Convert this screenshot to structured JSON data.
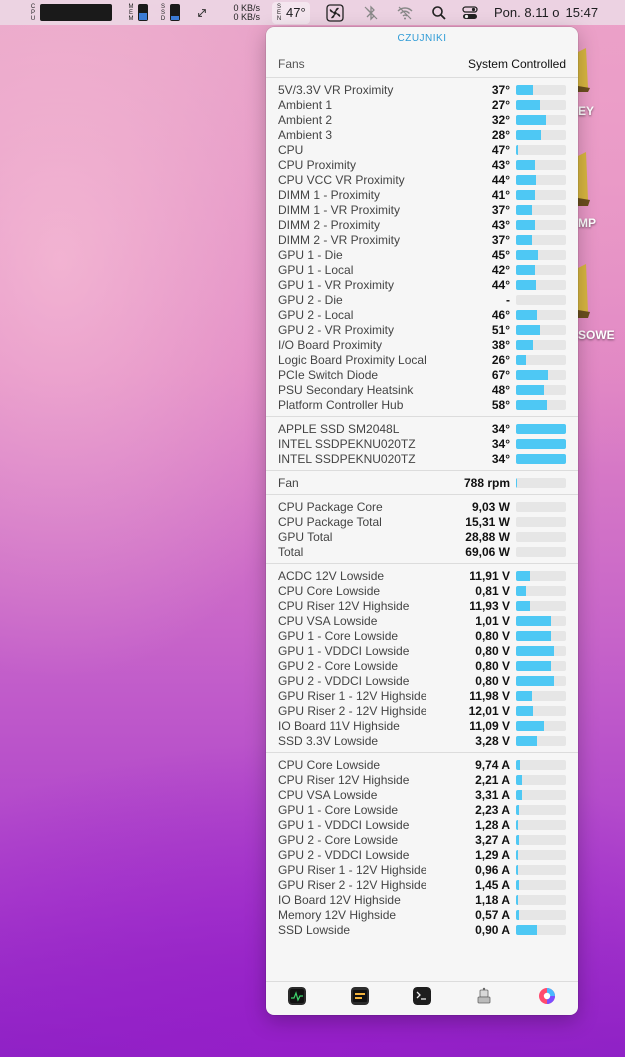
{
  "menubar": {
    "cpu_label": "CPU",
    "mem_label": "MEM",
    "ssd_label": "SSD",
    "net_up": "0 KB/s",
    "net_down": "0 KB/s",
    "sensor_label": "SEN",
    "temp": "47°",
    "datetime_day": "Pon. 8.11 o",
    "datetime_time": "15:47"
  },
  "desktop": {
    "labels": [
      "EY",
      "MP",
      "SOWE"
    ]
  },
  "popover": {
    "title": "CZUJNIKI",
    "fans": {
      "label": "Fans",
      "value": "System Controlled"
    },
    "temperatures": [
      {
        "name": "5V/3.3V VR Proximity",
        "value": "37°",
        "level": 0.33
      },
      {
        "name": "Ambient 1",
        "value": "27°",
        "level": 0.47
      },
      {
        "name": "Ambient 2",
        "value": "32°",
        "level": 0.59
      },
      {
        "name": "Ambient 3",
        "value": "28°",
        "level": 0.49
      },
      {
        "name": "CPU",
        "value": "47°",
        "level": 0.03
      },
      {
        "name": "CPU Proximity",
        "value": "43°",
        "level": 0.37
      },
      {
        "name": "CPU VCC VR Proximity",
        "value": "44°",
        "level": 0.39
      },
      {
        "name": "DIMM 1 - Proximity",
        "value": "41°",
        "level": 0.37
      },
      {
        "name": "DIMM 1 - VR Proximity",
        "value": "37°",
        "level": 0.31
      },
      {
        "name": "DIMM 2 - Proximity",
        "value": "43°",
        "level": 0.37
      },
      {
        "name": "DIMM 2 - VR Proximity",
        "value": "37°",
        "level": 0.31
      },
      {
        "name": "GPU 1 - Die",
        "value": "45°",
        "level": 0.43
      },
      {
        "name": "GPU 1 - Local",
        "value": "42°",
        "level": 0.37
      },
      {
        "name": "GPU 1 - VR Proximity",
        "value": "44°",
        "level": 0.39
      },
      {
        "name": "GPU 2 - Die",
        "value": "-",
        "level": 0
      },
      {
        "name": "GPU 2 - Local",
        "value": "46°",
        "level": 0.41
      },
      {
        "name": "GPU 2 - VR Proximity",
        "value": "51°",
        "level": 0.47
      },
      {
        "name": "I/O Board Proximity",
        "value": "38°",
        "level": 0.33
      },
      {
        "name": "Logic Board Proximity Local Board",
        "value": "26°",
        "level": 0.2
      },
      {
        "name": "PCIe Switch Diode",
        "value": "67°",
        "level": 0.63
      },
      {
        "name": "PSU Secondary Heatsink",
        "value": "48°",
        "level": 0.55
      },
      {
        "name": "Platform Controller Hub",
        "value": "58°",
        "level": 0.61
      }
    ],
    "disks": [
      {
        "name": "APPLE SSD SM2048L",
        "value": "34°",
        "level": 1.0
      },
      {
        "name": "INTEL SSDPEKNU020TZ",
        "value": "34°",
        "level": 1.0
      },
      {
        "name": "INTEL SSDPEKNU020TZ",
        "value": "34°",
        "level": 1.0
      }
    ],
    "fan": [
      {
        "name": "Fan",
        "value": "788 rpm",
        "level": 0.02
      }
    ],
    "power": [
      {
        "name": "CPU Package Core",
        "value": "9,03 W",
        "level": 0.0
      },
      {
        "name": "CPU Package Total",
        "value": "15,31 W",
        "level": 0.0
      },
      {
        "name": "GPU Total",
        "value": "28,88 W",
        "level": 0.0
      },
      {
        "name": "Total",
        "value": "69,06 W",
        "level": 0.0
      }
    ],
    "voltages": [
      {
        "name": "ACDC 12V Lowside",
        "value": "11,91 V",
        "level": 0.27
      },
      {
        "name": "CPU Core Lowside",
        "value": "0,81 V",
        "level": 0.2
      },
      {
        "name": "CPU Riser 12V Highside",
        "value": "11,93 V",
        "level": 0.27
      },
      {
        "name": "CPU VSA Lowside",
        "value": "1,01 V",
        "level": 0.69
      },
      {
        "name": "GPU 1 - Core Lowside",
        "value": "0,80 V",
        "level": 0.69
      },
      {
        "name": "GPU 1 - VDDCI Lowside",
        "value": "0,80 V",
        "level": 0.76
      },
      {
        "name": "GPU 2 - Core Lowside",
        "value": "0,80 V",
        "level": 0.69
      },
      {
        "name": "GPU 2 - VDDCI Lowside",
        "value": "0,80 V",
        "level": 0.76
      },
      {
        "name": "GPU Riser 1 - 12V Highside",
        "value": "11,98 V",
        "level": 0.31
      },
      {
        "name": "GPU Riser 2 - 12V Highside",
        "value": "12,01 V",
        "level": 0.33
      },
      {
        "name": "IO Board 11V Highside",
        "value": "11,09 V",
        "level": 0.55
      },
      {
        "name": "SSD 3.3V Lowside",
        "value": "3,28 V",
        "level": 0.41
      }
    ],
    "currents": [
      {
        "name": "CPU Core Lowside",
        "value": "9,74 A",
        "level": 0.08
      },
      {
        "name": "CPU Riser 12V Highside",
        "value": "2,21 A",
        "level": 0.12
      },
      {
        "name": "CPU VSA Lowside",
        "value": "3,31 A",
        "level": 0.12
      },
      {
        "name": "GPU 1 - Core Lowside",
        "value": "2,23 A",
        "level": 0.06
      },
      {
        "name": "GPU 1 - VDDCI Lowside",
        "value": "1,28 A",
        "level": 0.04
      },
      {
        "name": "GPU 2 - Core Lowside",
        "value": "3,27 A",
        "level": 0.06
      },
      {
        "name": "GPU 2 - VDDCI Lowside",
        "value": "1,29 A",
        "level": 0.04
      },
      {
        "name": "GPU Riser 1 - 12V Highside",
        "value": "0,96 A",
        "level": 0.04
      },
      {
        "name": "GPU Riser 2 - 12V Highside",
        "value": "1,45 A",
        "level": 0.06
      },
      {
        "name": "IO Board 12V Highside",
        "value": "1,18 A",
        "level": 0.04
      },
      {
        "name": "Memory 12V Highside",
        "value": "0,57 A",
        "level": 0.06
      },
      {
        "name": "SSD Lowside",
        "value": "0,90 A",
        "level": 0.41
      }
    ],
    "footer_icons": [
      "activity-monitor-icon",
      "console-icon",
      "terminal-icon",
      "script-editor-icon",
      "color-picker-icon"
    ]
  },
  "colors": {
    "bar_fill": "#4ec8f4",
    "title_blue": "#2e9bd6"
  }
}
